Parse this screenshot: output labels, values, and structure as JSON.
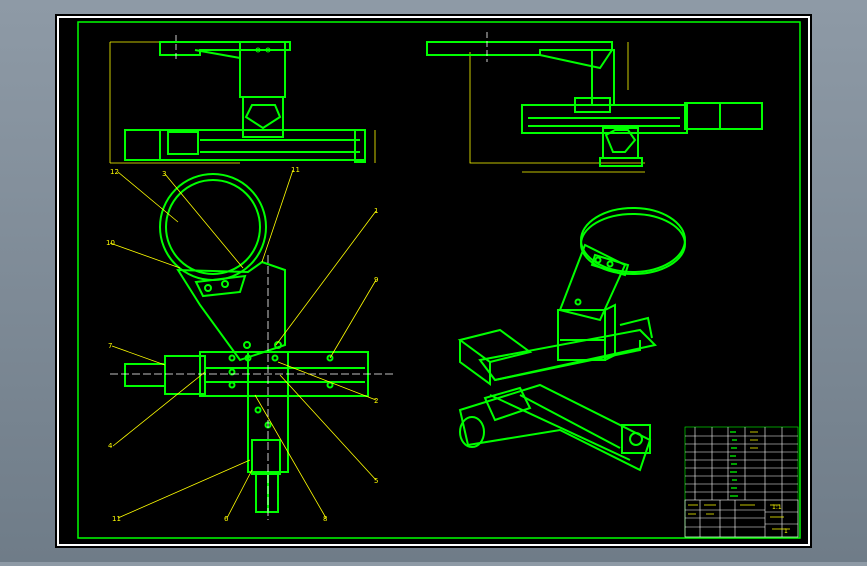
{
  "colors": {
    "background": "#8e9aa6",
    "sheet": "#000000",
    "border": "#ffffff",
    "frame": "#00ff00",
    "geometry": "#00ff00",
    "dimension": "#ffff00",
    "centerline": "#ffffff"
  },
  "callouts": [
    {
      "label": "12"
    },
    {
      "label": "3"
    },
    {
      "label": "11"
    },
    {
      "label": "1"
    },
    {
      "label": "10"
    },
    {
      "label": "9"
    },
    {
      "label": "7"
    },
    {
      "label": "4"
    },
    {
      "label": "2"
    },
    {
      "label": "5"
    },
    {
      "label": "11"
    },
    {
      "label": "6"
    },
    {
      "label": "8"
    }
  ],
  "title_block": {
    "scale": "1:1",
    "sheet": "1"
  }
}
